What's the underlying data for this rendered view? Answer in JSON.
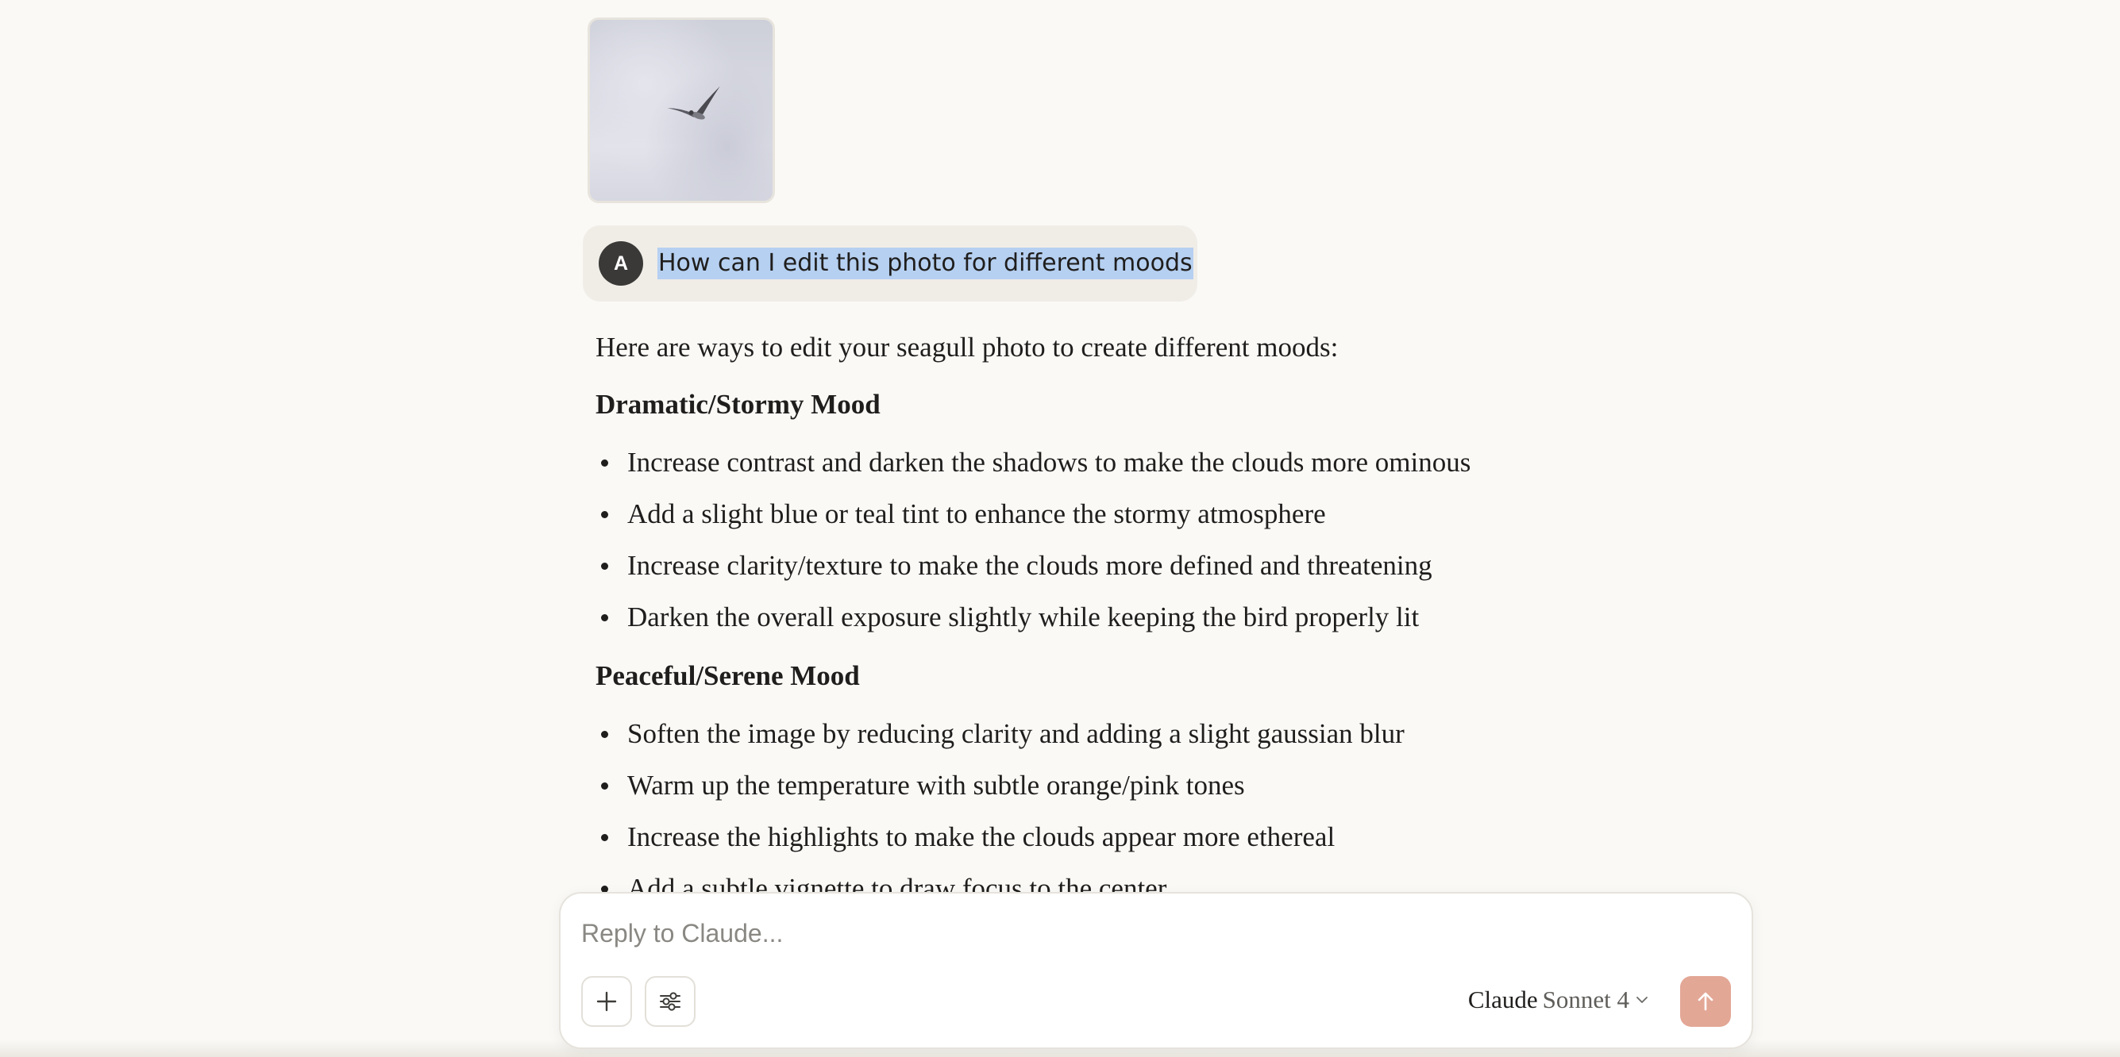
{
  "user_message": {
    "avatar_initial": "A",
    "text": "How can I edit this photo for different moods"
  },
  "response": {
    "intro": "Here are ways to edit your seagull photo to create different moods:",
    "sections": [
      {
        "heading": "Dramatic/Stormy Mood",
        "items": [
          "Increase contrast and darken the shadows to make the clouds more ominous",
          "Add a slight blue or teal tint to enhance the stormy atmosphere",
          "Increase clarity/texture to make the clouds more defined and threatening",
          "Darken the overall exposure slightly while keeping the bird properly lit"
        ]
      },
      {
        "heading": "Peaceful/Serene Mood",
        "items": [
          "Soften the image by reducing clarity and adding a slight gaussian blur",
          "Warm up the temperature with subtle orange/pink tones",
          "Increase the highlights to make the clouds appear more ethereal",
          "Add a subtle vignette to draw focus to the center"
        ]
      }
    ]
  },
  "composer": {
    "placeholder": "Reply to Claude...",
    "model_brand": "Claude",
    "model_name": "Sonnet 4"
  },
  "icons": {
    "add": "plus-icon",
    "tools": "sliders-icon",
    "model_dropdown": "chevron-down-icon",
    "send": "arrow-up-icon"
  },
  "colors": {
    "background": "#faf9f6",
    "user_bubble": "#f0ede7",
    "selection_highlight": "#b6d0f1",
    "send_button": "#e3a796"
  }
}
